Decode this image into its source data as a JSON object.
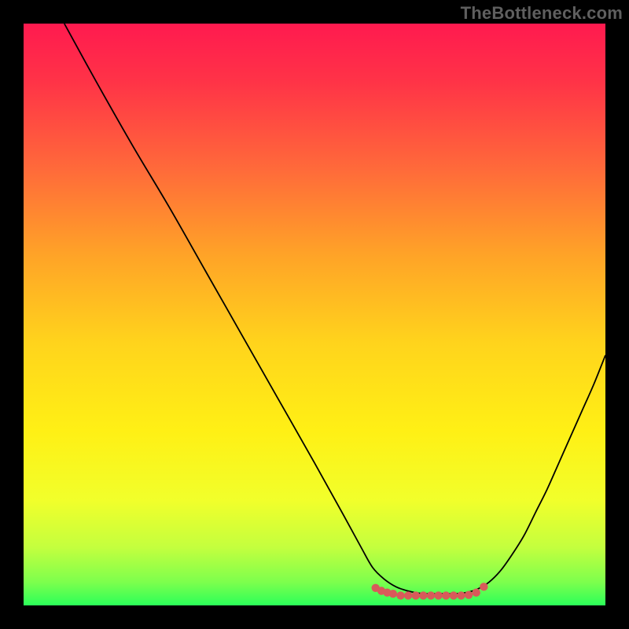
{
  "watermark": "TheBottleneck.com",
  "chart_data": {
    "type": "line",
    "title": "",
    "xlabel": "",
    "ylabel": "",
    "xlim": [
      0,
      100
    ],
    "ylim": [
      0,
      100
    ],
    "grid": false,
    "series": [
      {
        "name": "curve",
        "style": "black-line",
        "x": [
          7,
          12.5,
          18.75,
          25,
          31.25,
          37.5,
          43.75,
          50,
          55,
          58,
          60,
          62,
          64,
          66,
          68,
          70,
          72,
          74,
          76,
          78,
          80,
          82,
          84,
          86,
          88,
          90,
          92,
          94,
          96,
          98,
          100
        ],
        "y": [
          100,
          90,
          79,
          68.5,
          57.5,
          46.5,
          35.5,
          24.5,
          15.5,
          10,
          6.5,
          4.5,
          3.2,
          2.5,
          2.1,
          2.0,
          2.0,
          2.0,
          2.2,
          2.8,
          4.0,
          6.0,
          8.8,
          12.0,
          16.0,
          20.0,
          24.5,
          29.0,
          33.5,
          38.0,
          43.0
        ]
      },
      {
        "name": "optimal-band",
        "style": "red-dots",
        "x": [
          60.5,
          61.5,
          62.5,
          63.5,
          64.8,
          66.1,
          67.4,
          68.7,
          70.0,
          71.3,
          72.6,
          73.9,
          75.2,
          76.5,
          77.8,
          79.1
        ],
        "y": [
          3.0,
          2.5,
          2.2,
          2.0,
          1.7,
          1.7,
          1.7,
          1.7,
          1.7,
          1.7,
          1.7,
          1.7,
          1.7,
          1.8,
          2.2,
          3.2
        ]
      }
    ],
    "gradient_stops": [
      {
        "offset": 0.0,
        "color": "#ff1a4f"
      },
      {
        "offset": 0.1,
        "color": "#ff3347"
      },
      {
        "offset": 0.25,
        "color": "#ff6a3a"
      },
      {
        "offset": 0.4,
        "color": "#ffa427"
      },
      {
        "offset": 0.55,
        "color": "#ffd41c"
      },
      {
        "offset": 0.7,
        "color": "#fff015"
      },
      {
        "offset": 0.82,
        "color": "#f1ff2b"
      },
      {
        "offset": 0.9,
        "color": "#c4ff3e"
      },
      {
        "offset": 0.96,
        "color": "#7dff4d"
      },
      {
        "offset": 1.0,
        "color": "#2bff59"
      }
    ]
  }
}
